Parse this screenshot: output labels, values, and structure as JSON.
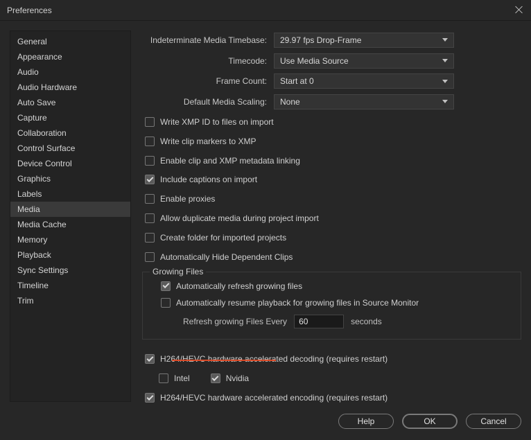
{
  "window": {
    "title": "Preferences"
  },
  "sidebar": {
    "items": [
      {
        "label": "General"
      },
      {
        "label": "Appearance"
      },
      {
        "label": "Audio"
      },
      {
        "label": "Audio Hardware"
      },
      {
        "label": "Auto Save"
      },
      {
        "label": "Capture"
      },
      {
        "label": "Collaboration"
      },
      {
        "label": "Control Surface"
      },
      {
        "label": "Device Control"
      },
      {
        "label": "Graphics"
      },
      {
        "label": "Labels"
      },
      {
        "label": "Media"
      },
      {
        "label": "Media Cache"
      },
      {
        "label": "Memory"
      },
      {
        "label": "Playback"
      },
      {
        "label": "Sync Settings"
      },
      {
        "label": "Timeline"
      },
      {
        "label": "Trim"
      }
    ],
    "selected_index": 11
  },
  "form": {
    "timebase_label": "Indeterminate Media Timebase:",
    "timebase_value": "29.97 fps Drop-Frame",
    "timecode_label": "Timecode:",
    "timecode_value": "Use Media Source",
    "framecount_label": "Frame Count:",
    "framecount_value": "Start at 0",
    "scaling_label": "Default Media Scaling:",
    "scaling_value": "None"
  },
  "checks": {
    "write_xmp": "Write XMP ID to files on import",
    "write_clip_markers": "Write clip markers to XMP",
    "enable_clip_xmp": "Enable clip and XMP metadata linking",
    "include_captions": "Include captions on import",
    "enable_proxies": "Enable proxies",
    "allow_duplicate": "Allow duplicate media during project import",
    "create_folder": "Create folder for imported projects",
    "auto_hide": "Automatically Hide Dependent Clips"
  },
  "growing": {
    "legend": "Growing Files",
    "auto_refresh": "Automatically refresh growing files",
    "auto_resume": "Automatically resume playback for growing files in Source Monitor",
    "refresh_prefix": "Refresh growing Files Every",
    "refresh_value": "60",
    "refresh_suffix": "seconds"
  },
  "hw": {
    "decode": "H264/HEVC hardware accelerated decoding (requires restart)",
    "intel": "Intel",
    "nvidia": "Nvidia",
    "encode": "H264/HEVC hardware accelerated encoding (requires restart)"
  },
  "footer": {
    "help": "Help",
    "ok": "OK",
    "cancel": "Cancel"
  }
}
